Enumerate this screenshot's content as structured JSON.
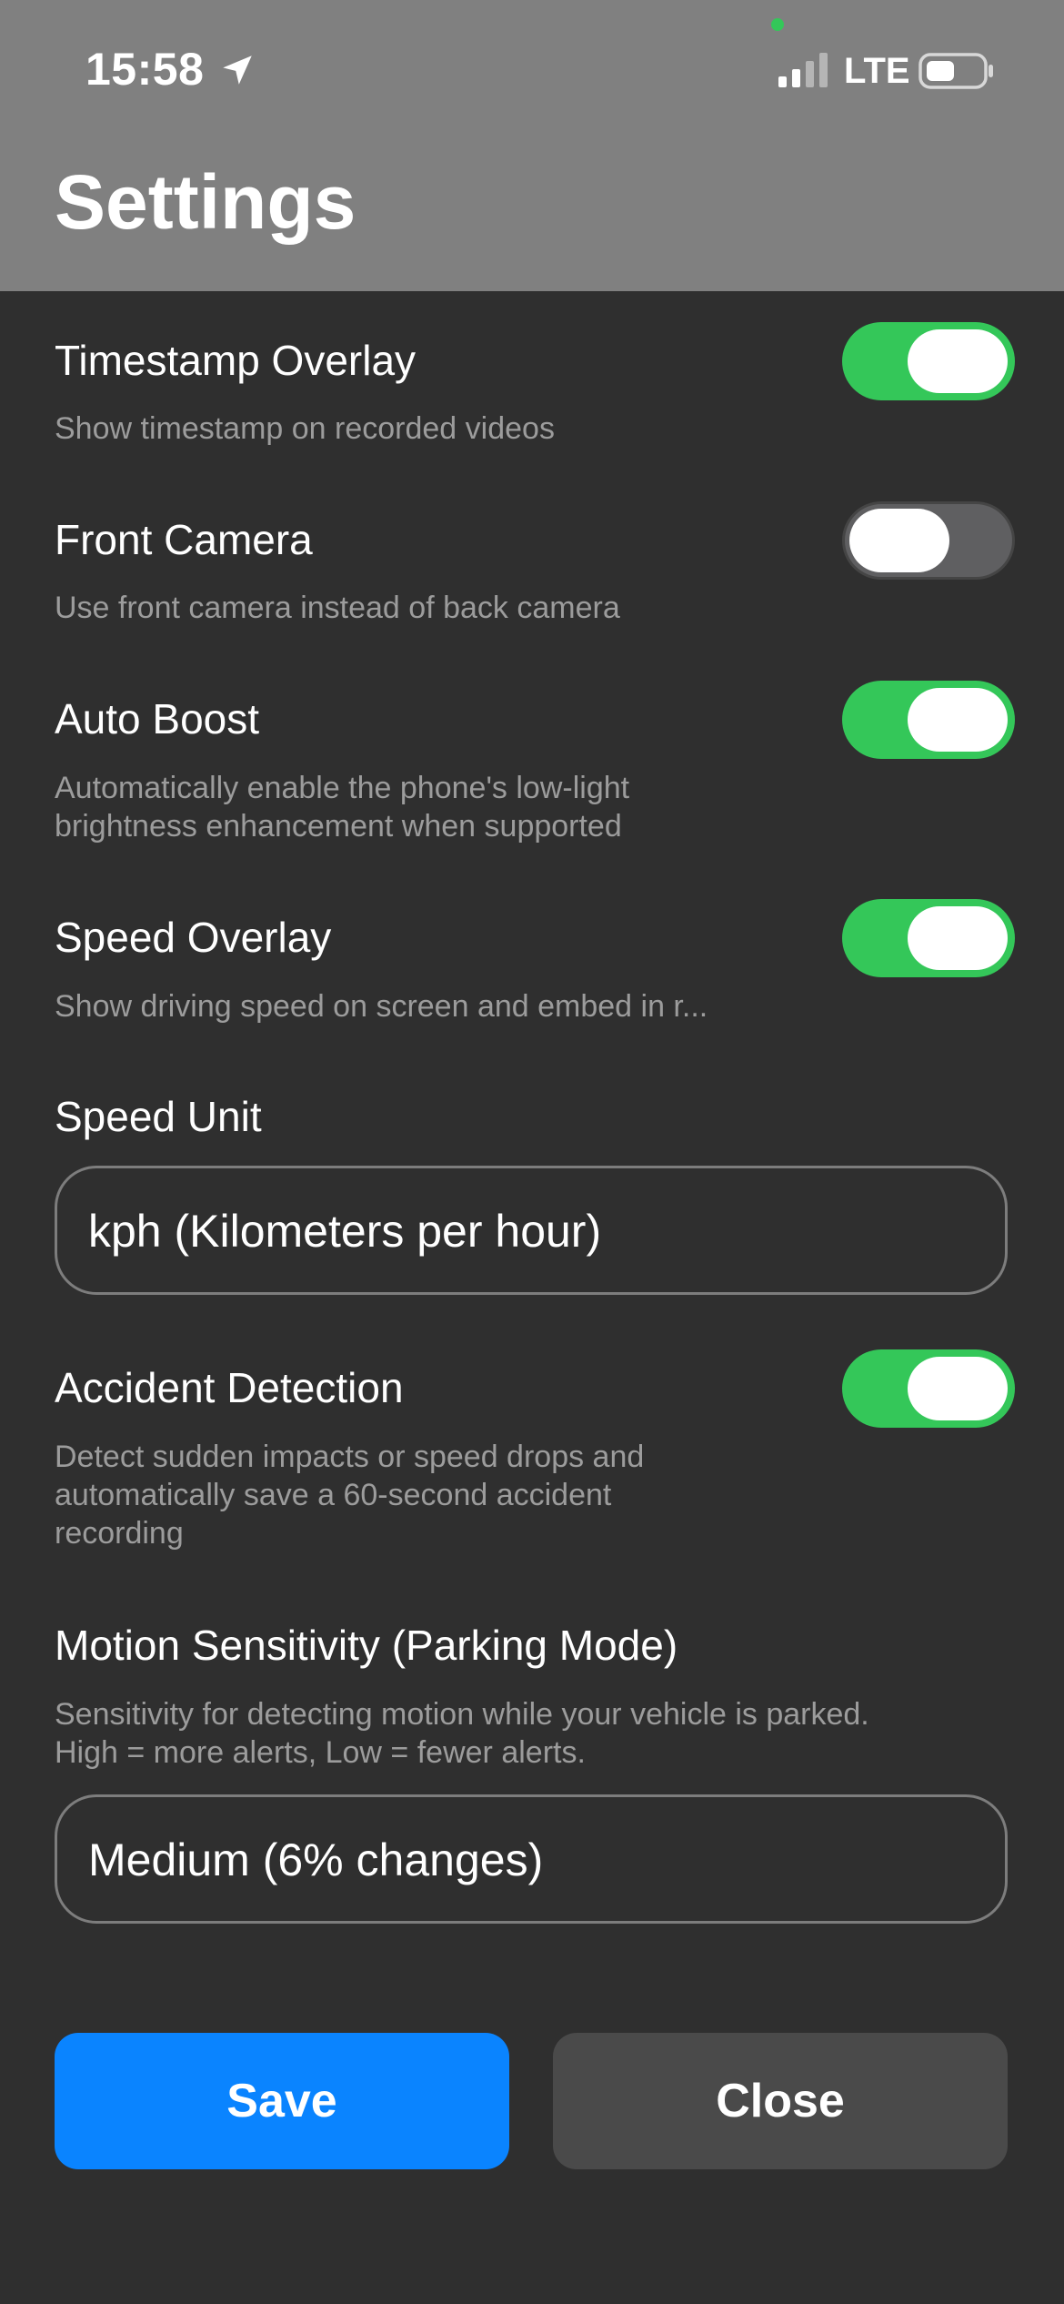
{
  "status_bar": {
    "time": "15:58",
    "network": "LTE",
    "icons": [
      "location-arrow-icon",
      "cellular-signal-icon",
      "battery-icon"
    ],
    "privacy_dot_color": "#34c759"
  },
  "header": {
    "title": "Settings",
    "background": "#808080"
  },
  "settings": {
    "timestamp_overlay": {
      "title": "Timestamp Overlay",
      "description": "Show timestamp on recorded videos",
      "enabled": true
    },
    "front_camera": {
      "title": "Front Camera",
      "description": "Use front camera instead of back camera",
      "enabled": false
    },
    "auto_boost": {
      "title": "Auto Boost",
      "description_line1": "Automatically enable the phone's low-light",
      "description_line2": "brightness enhancement when supported",
      "enabled": true
    },
    "speed_overlay": {
      "title": "Speed Overlay",
      "description": "Show driving speed on screen and embed in r...",
      "enabled": true
    },
    "speed_unit": {
      "title": "Speed Unit",
      "value": "kph (Kilometers per hour)"
    },
    "accident_detection": {
      "title": "Accident Detection",
      "description_line1": "Detect sudden impacts or speed drops and",
      "description_line2": "automatically save a 60-second accident",
      "description_line3": "recording",
      "enabled": true
    },
    "motion_sensitivity": {
      "title": "Motion Sensitivity (Parking Mode)",
      "description_line1": "Sensitivity for detecting motion while your vehicle is parked.",
      "description_line2": "High = more alerts, Low = fewer alerts.",
      "value": "Medium (6% changes)"
    }
  },
  "actions": {
    "save_label": "Save",
    "close_label": "Close"
  },
  "colors": {
    "background": "#2f2f2f",
    "toggle_on": "#34c759",
    "toggle_off": "#5f5f61",
    "primary_button": "#0a84ff",
    "secondary_button": "#4a4a4a",
    "secondary_text": "#9c9c9c"
  }
}
